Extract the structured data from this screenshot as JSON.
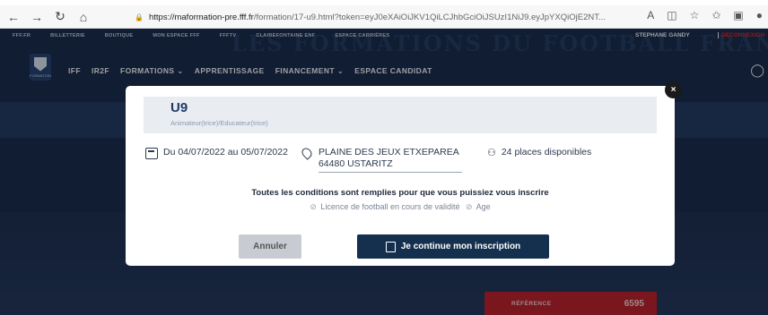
{
  "browser": {
    "url_domain": "https://maformation-pre.fff.fr",
    "url_rest": "/formation/17-u9.html?token=eyJ0eXAiOiJKV1QiLCJhbGciOiJSUzI1NiJ9.eyJpYXQiOjE2NT...",
    "back_icon": "←",
    "forward_icon": "→",
    "reload_icon": "↻",
    "home_icon": "⌂",
    "lock_icon": "🔒"
  },
  "site": {
    "bg_title": "LES FORMATIONS DU FOOTBALL FRANÇAIS",
    "top_links": [
      "FFF.FR",
      "BILLETTERIE",
      "BOUTIQUE",
      "MON ESPACE FFF",
      "FFFTV",
      "CLAIREFONTAINE ENF",
      "ESPACE CARRIÈRES"
    ],
    "user_name": "STEPHANE GANDY",
    "logout_label": "DÉCONNEXION",
    "logo_text": "FORMATION",
    "nav": [
      "IFF",
      "IR2F",
      "FORMATIONS ⌄",
      "APPRENTISSAGE",
      "FINANCEMENT ⌄",
      "ESPACE CANDIDAT"
    ],
    "reference_label": "RÉFÉRENCE",
    "reference_value": "6595"
  },
  "modal": {
    "close_label": "×",
    "course_title": "U9",
    "course_role": "Animateur(trice)/Educateur(trice)",
    "date_text": "Du 04/07/2022 au 05/07/2022",
    "location_line1": "PLAINE DES JEUX ETXEPAREA",
    "location_line2": "64480 USTARITZ",
    "places_text": "24 places disponibles",
    "conditions_text": "Toutes les conditions sont remplies pour que vous puissiez vous inscrire",
    "condition_items": [
      "Licence de football en cours de validité",
      "Age"
    ],
    "cancel_label": "Annuler",
    "continue_label": "Je continue mon inscription"
  }
}
